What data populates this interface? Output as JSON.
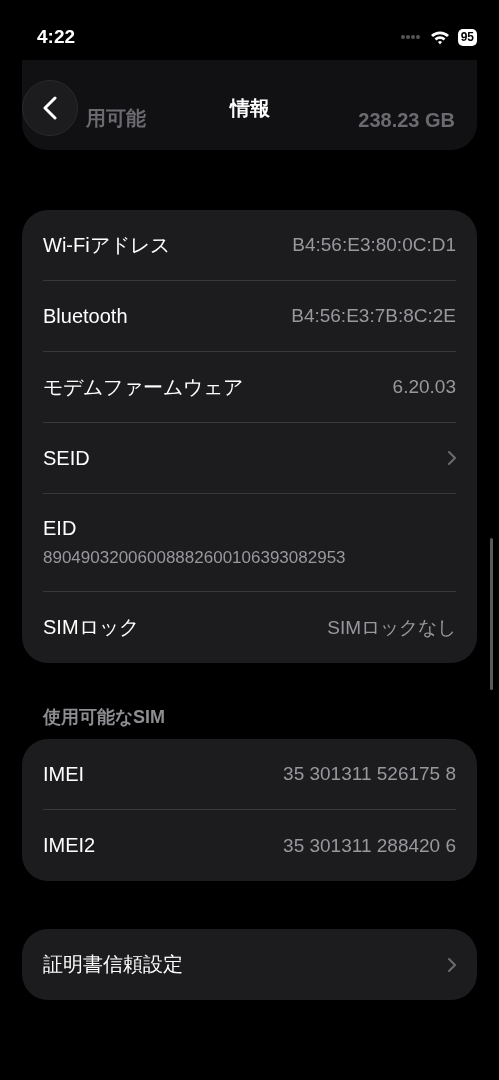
{
  "status_bar": {
    "time": "4:22",
    "battery": "95"
  },
  "nav": {
    "title": "情報"
  },
  "behind_row": {
    "label": "用可能",
    "value": "238.23 GB"
  },
  "groups": [
    {
      "rows": [
        {
          "kind": "value",
          "label": "Wi-Fiアドレス",
          "value": "B4:56:E3:80:0C:D1"
        },
        {
          "kind": "value",
          "label": "Bluetooth",
          "value": "B4:56:E3:7B:8C:2E"
        },
        {
          "kind": "value",
          "label": "モデムファームウェア",
          "value": "6.20.03"
        },
        {
          "kind": "chevron",
          "label": "SEID"
        },
        {
          "kind": "stacked",
          "label": "EID",
          "value": "89049032006008882600106393082953"
        },
        {
          "kind": "value",
          "label": "SIMロック",
          "value": "SIMロックなし"
        }
      ]
    },
    {
      "header": "使用可能なSIM",
      "rows": [
        {
          "kind": "value",
          "label": "IMEI",
          "value": "35 301311 526175 8"
        },
        {
          "kind": "value",
          "label": "IMEI2",
          "value": "35 301311 288420 6"
        }
      ]
    },
    {
      "rows": [
        {
          "kind": "chevron",
          "label": "証明書信頼設定"
        }
      ]
    }
  ]
}
